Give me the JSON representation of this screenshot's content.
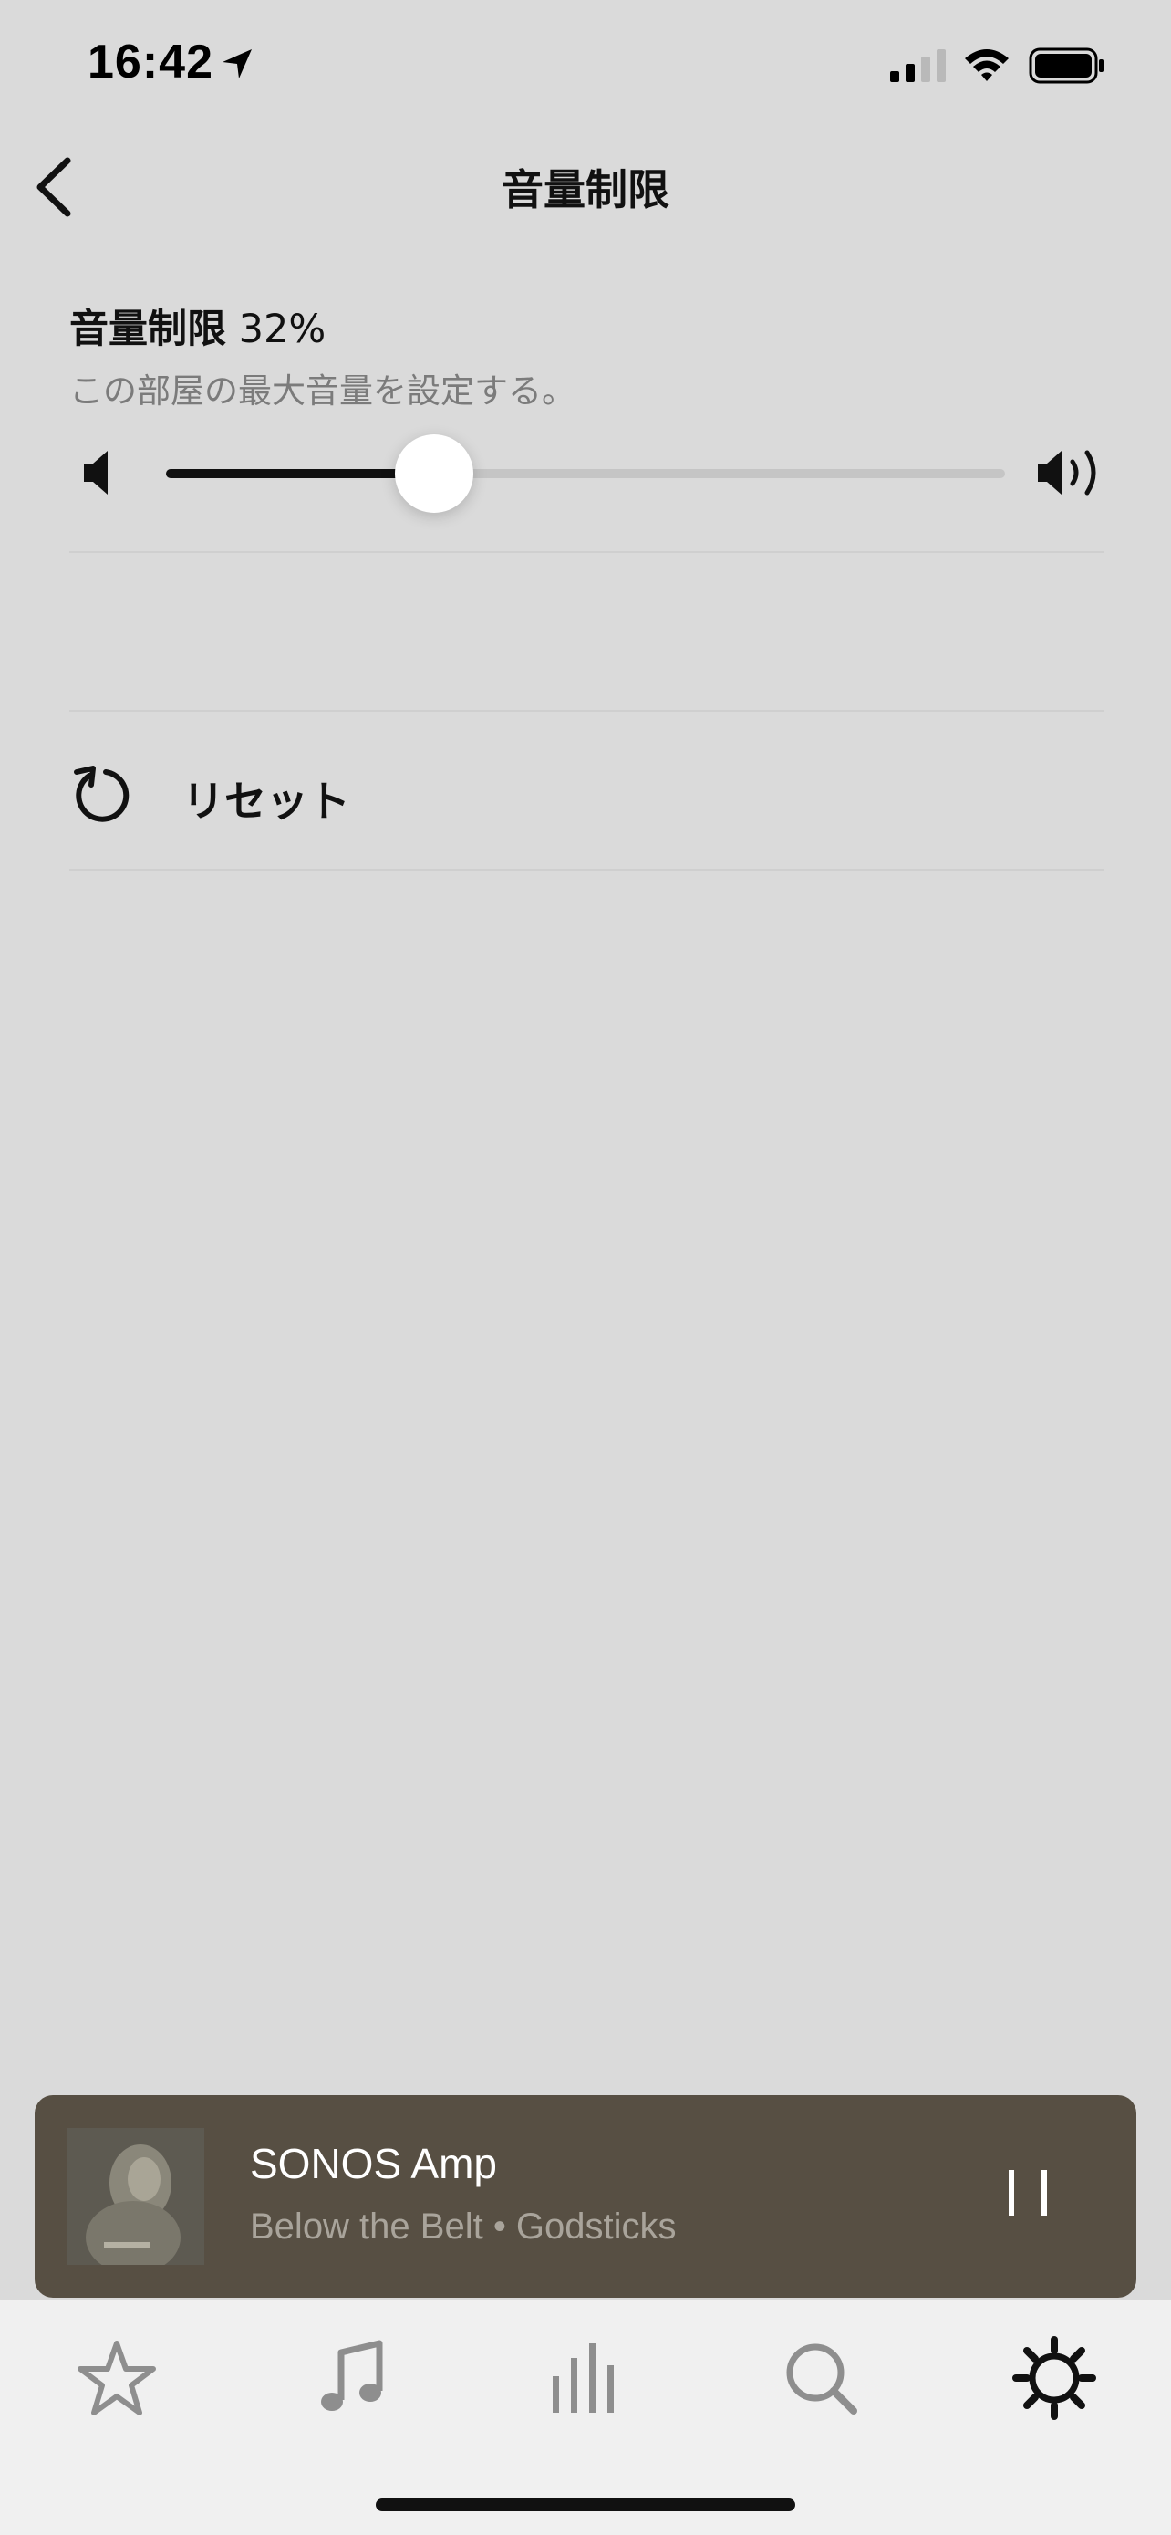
{
  "status_bar": {
    "time": "16:42",
    "icons": [
      "location-arrow-icon",
      "cellular-signal-icon",
      "wifi-icon",
      "battery-icon"
    ]
  },
  "header": {
    "title": "音量制限",
    "back_icon": "chevron-left-icon"
  },
  "volume_limit": {
    "label": "音量制限",
    "percent_text": "32%",
    "description": "この部屋の最大音量を設定する。",
    "value_fraction": 0.32,
    "min_icon": "speaker-mute-icon",
    "max_icon": "speaker-loud-icon"
  },
  "reset": {
    "label": "リセット",
    "icon": "reset-icon"
  },
  "now_playing": {
    "room": "SONOS Amp",
    "subtitle": "Below the Belt • Godsticks",
    "control_icon": "pause-icon"
  },
  "tab_bar": {
    "tabs": [
      {
        "name": "favorites",
        "icon": "star-icon",
        "active": false
      },
      {
        "name": "browse",
        "icon": "music-note-icon",
        "active": false
      },
      {
        "name": "rooms",
        "icon": "equalizer-bars-icon",
        "active": false
      },
      {
        "name": "search",
        "icon": "search-icon",
        "active": false
      },
      {
        "name": "settings",
        "icon": "gear-icon",
        "active": true
      }
    ]
  },
  "colors": {
    "background": "#dadada",
    "now_playing_bg": "#574f43",
    "tab_bar_bg": "#f0f0f0",
    "active_tab": "#111111",
    "inactive_tab": "#8e8e8e"
  }
}
